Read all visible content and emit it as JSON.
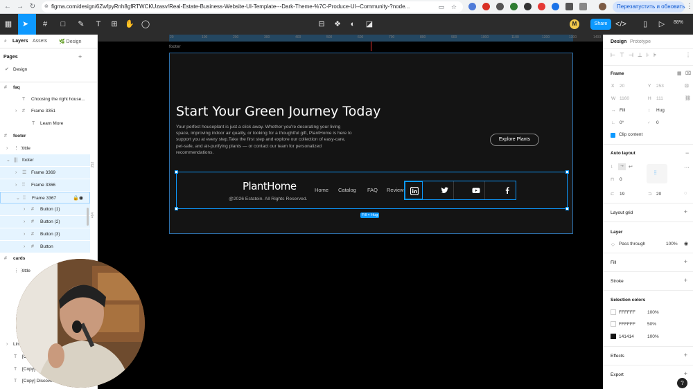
{
  "browser": {
    "url": "figma.com/design/6ZwfpyRnh8gfRTWCKUzasv/Real-Estate-Business-Website-UI-Template---Dark-Theme-%7C-Produce-UI--Community-?node...",
    "restart_label": "Перезапустить и обновить"
  },
  "toolbar": {
    "share_label": "Share",
    "zoom": "88%",
    "avatar_initial": "M"
  },
  "left_panel": {
    "tabs": [
      "Layers",
      "Assets"
    ],
    "page_label": "Design",
    "pages_heading": "Pages",
    "current_page": "Design",
    "layers": [
      {
        "label": "faq"
      },
      {
        "label": "Choosing the right house..."
      },
      {
        "label": "Frame 3351"
      },
      {
        "label": "Learn More"
      },
      {
        "label": "footer"
      },
      {
        "label": "tittle"
      },
      {
        "label": "footer"
      },
      {
        "label": "Frame 3369"
      },
      {
        "label": "Frame 3366"
      },
      {
        "label": "Frame 3367"
      },
      {
        "label": "Button (1)"
      },
      {
        "label": "Button (2)"
      },
      {
        "label": "Button (3)"
      },
      {
        "label": "Button"
      },
      {
        "label": "cards"
      },
      {
        "label": "tittle"
      },
      {
        "label": "Lin"
      },
      {
        "label": "[Co"
      },
      {
        "label": "[Copy] Disco"
      },
      {
        "label": "[Copy] Discover"
      }
    ],
    "side_numbers": [
      "253",
      "464"
    ]
  },
  "canvas": {
    "ruler_ticks": [
      "20",
      "100",
      "200",
      "300",
      "400",
      "500",
      "600",
      "700",
      "800",
      "900",
      "1000",
      "1100",
      "1200",
      "1300",
      "1400"
    ],
    "frame_label": "footer",
    "headline": "Start Your Green Journey Today",
    "paragraph": "Your perfect houseplant is just a click away. Whether you're decorating your living space, improving indoor air quality, or looking for a thoughtful gift, PlantHome is here to support you at every step.Take the first step and explore our collection of easy-care, pet-safe, and air-purifying plants — or contact our team for personalized recommendations.",
    "cta_label": "Explore Plants",
    "logo": "PlantHome",
    "copyright": "@2026 Estatein. All Rights Reserved.",
    "nav_links": [
      "Home",
      "Catalog",
      "FAQ",
      "Review"
    ],
    "social_icons": [
      "linkedin-icon",
      "twitter-icon",
      "youtube-icon",
      "facebook-icon"
    ],
    "size_badge": "Fill × Hug"
  },
  "right_panel": {
    "tabs": [
      "Design",
      "Prototype"
    ],
    "frame_heading": "Frame",
    "x_label": "X",
    "x_value": "20",
    "y_label": "Y",
    "y_value": "253",
    "w_label": "W",
    "w_value": "1160",
    "h_label": "H",
    "h_value": "111",
    "fill_label": "Fill",
    "hug_label": "Hug",
    "rotation": "0°",
    "radius": "0",
    "radius2": "0",
    "clip_label": "Clip content",
    "auto_layout_heading": "Auto layout",
    "gap_value": "0",
    "pad_h": "19",
    "pad_v": "20",
    "layout_grid_heading": "Layout grid",
    "layer_heading": "Layer",
    "blend_mode": "Pass through",
    "opacity": "100%",
    "fill_heading": "Fill",
    "stroke_heading": "Stroke",
    "selection_colors_heading": "Selection colors",
    "selection_colors": [
      {
        "hex": "FFFFFF",
        "opacity": "100%",
        "color": "#FFFFFF"
      },
      {
        "hex": "FFFFFF",
        "opacity": "50%",
        "color": "#FFFFFF"
      },
      {
        "hex": "141414",
        "opacity": "100%",
        "color": "#141414"
      }
    ],
    "effects_heading": "Effects",
    "export_heading": "Export"
  },
  "colors": {
    "accent": "#0d99ff",
    "canvas_bg": "#000000",
    "frame_bg": "#141414"
  }
}
